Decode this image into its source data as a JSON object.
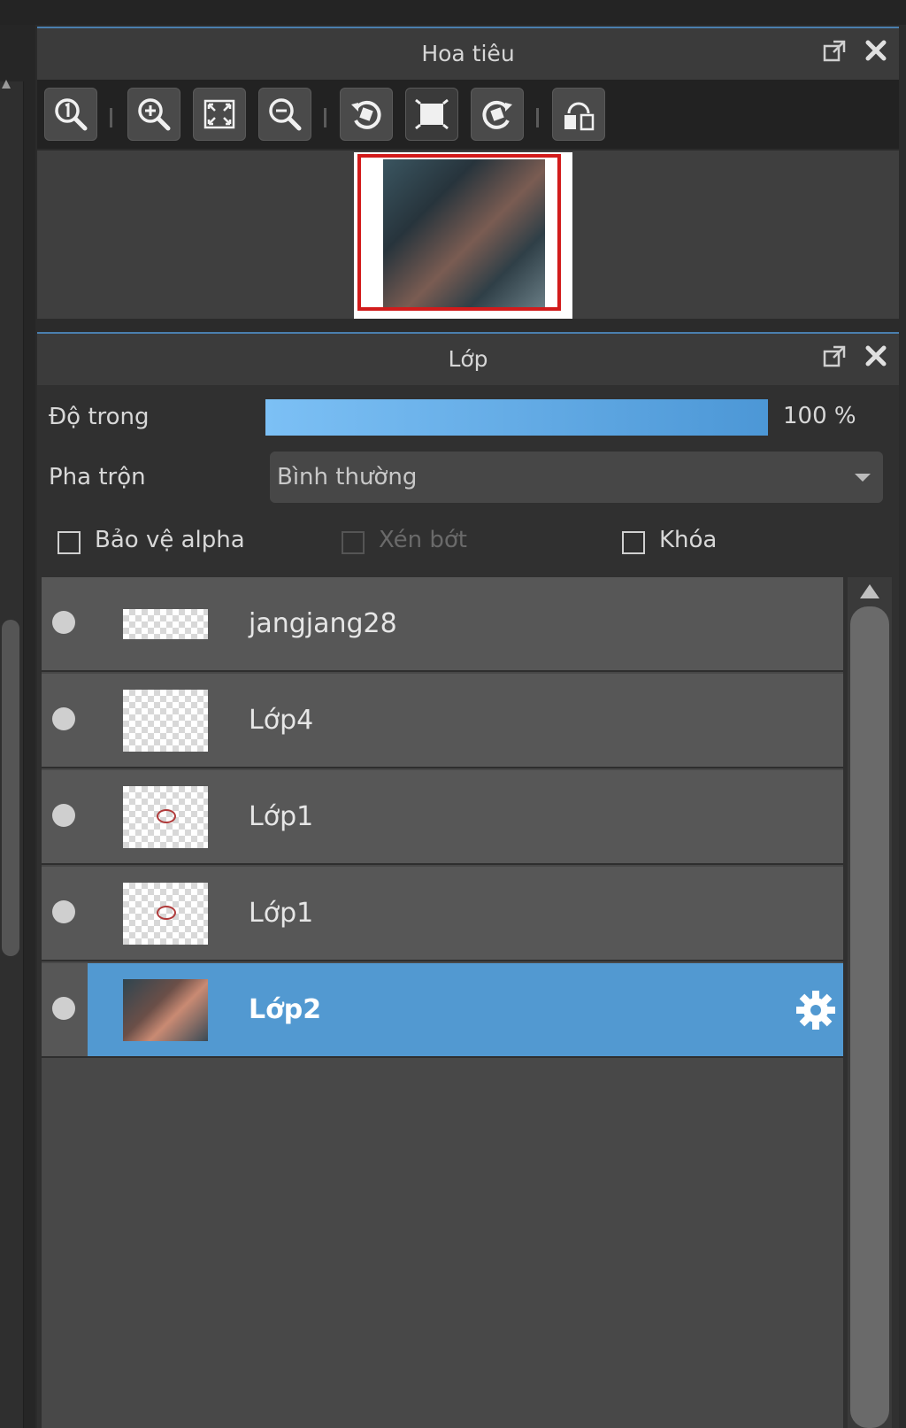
{
  "navigator": {
    "title": "Hoa tiêu",
    "toolbar_icons": [
      "zoom-actual-size-icon",
      "zoom-in-icon",
      "fit-to-window-icon",
      "zoom-out-icon",
      "rotate-left-icon",
      "fit-canvas-icon",
      "rotate-right-icon",
      "flip-horizontal-icon"
    ]
  },
  "layers_panel": {
    "title": "Lớp",
    "opacity_label": "Độ trong",
    "opacity_value": "100 %",
    "opacity_fraction": 1.0,
    "blend_label": "Pha trộn",
    "blend_value": "Bình thường",
    "protect_alpha_label": "Bảo vệ alpha",
    "clipping_label": "Xén bớt",
    "lock_label": "Khóa",
    "layers": [
      {
        "name": "jangjang28",
        "selected": false
      },
      {
        "name": "Lớp4",
        "selected": false
      },
      {
        "name": "Lớp1",
        "selected": false
      },
      {
        "name": "Lớp1",
        "selected": false
      },
      {
        "name": "Lớp2",
        "selected": true
      }
    ]
  },
  "colors": {
    "accent": "#5299d1",
    "thumbnail_frame": "#d21b1b"
  }
}
